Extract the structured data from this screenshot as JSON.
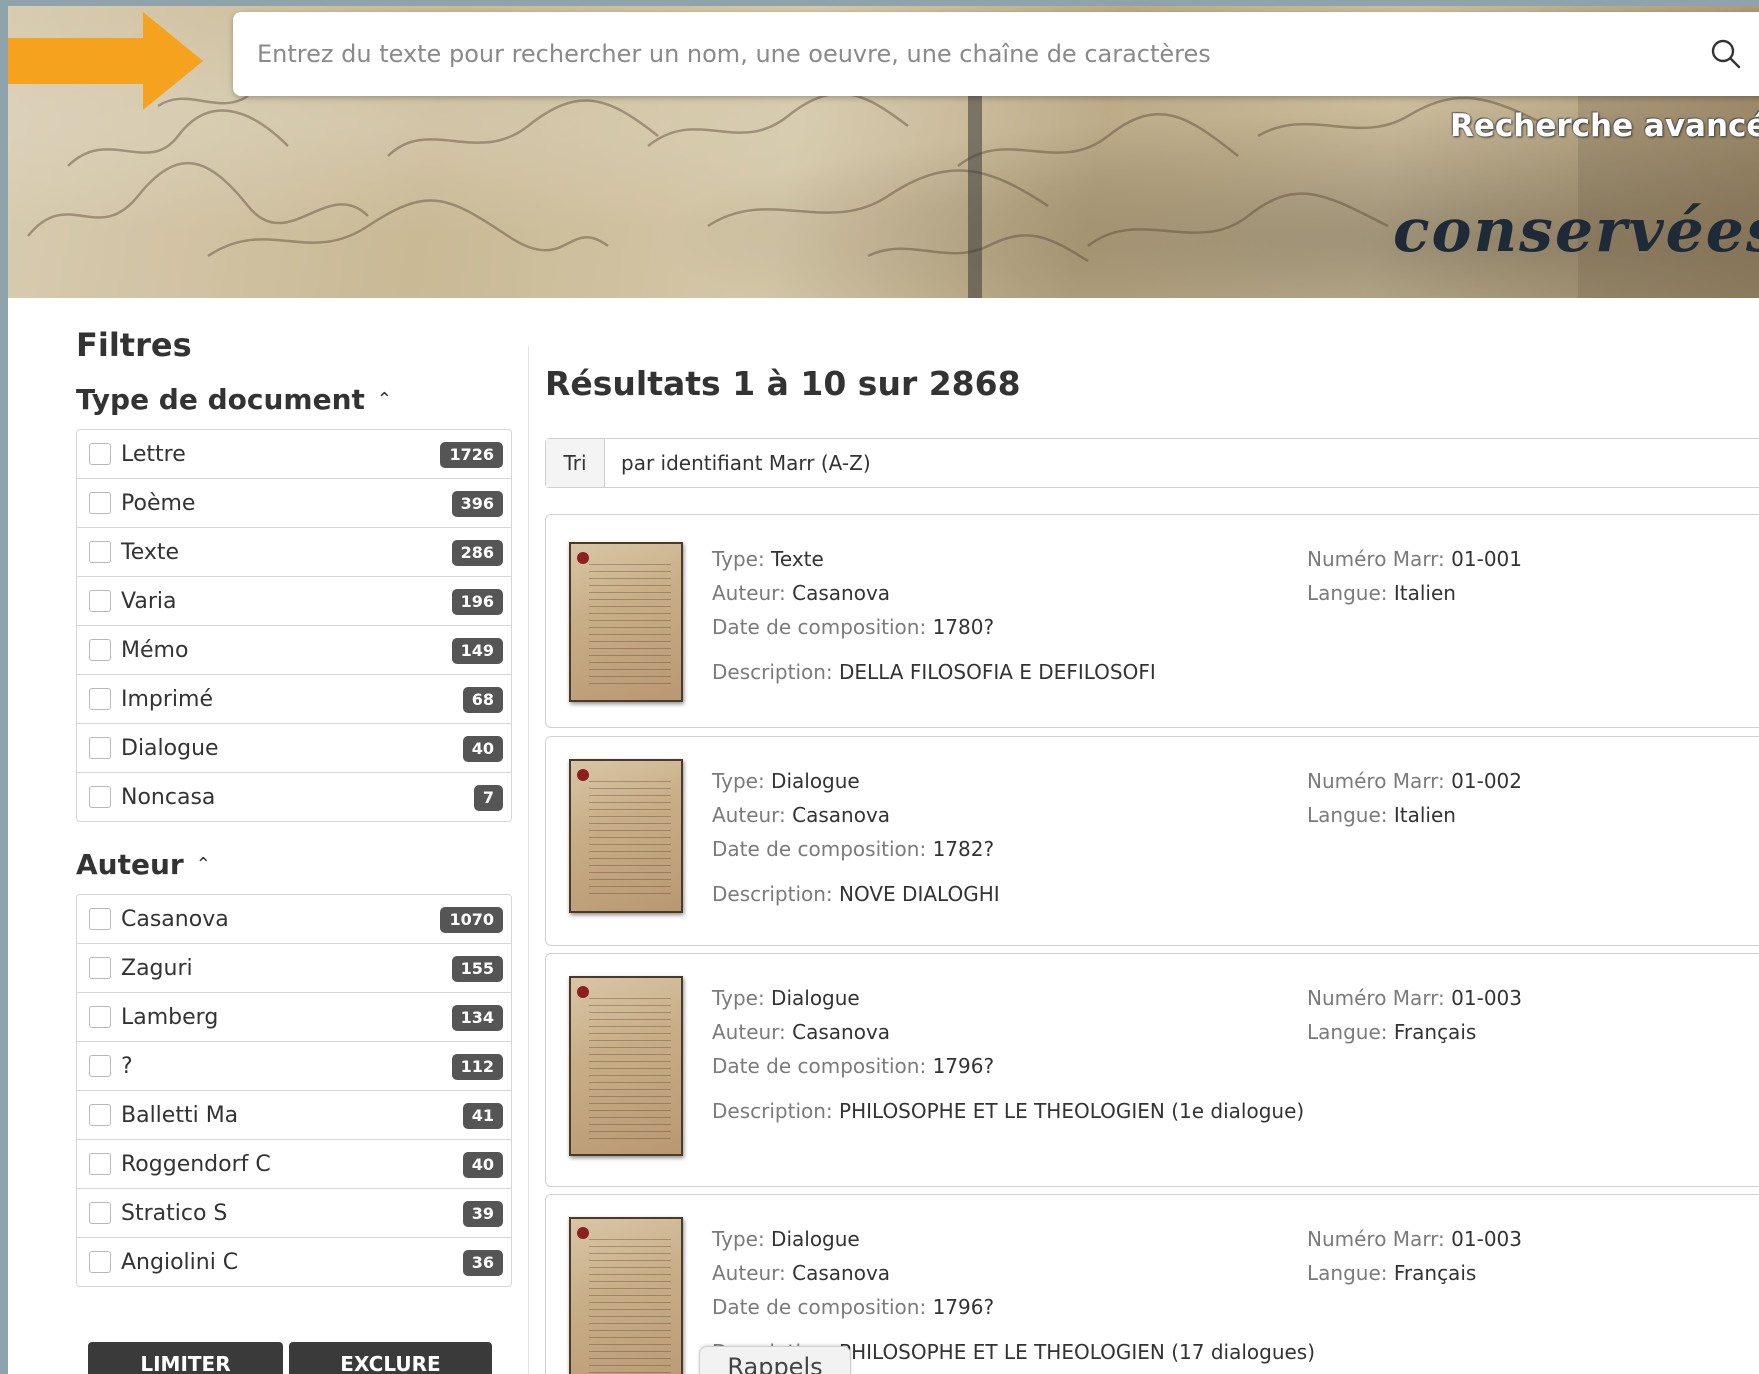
{
  "search": {
    "placeholder": "Entrez du texte pour rechercher un nom, une oeuvre, une chaîne de caractères",
    "icon": "search-icon"
  },
  "banner": {
    "advanced_search_label": "Recherche avancée",
    "script_text": "conservées au"
  },
  "filters": {
    "title": "Filtres",
    "facets": [
      {
        "title": "Type de document",
        "items": [
          {
            "label": "Lettre",
            "count": "1726"
          },
          {
            "label": "Poème",
            "count": "396"
          },
          {
            "label": "Texte",
            "count": "286"
          },
          {
            "label": "Varia",
            "count": "196"
          },
          {
            "label": "Mémo",
            "count": "149"
          },
          {
            "label": "Imprimé",
            "count": "68"
          },
          {
            "label": "Dialogue",
            "count": "40"
          },
          {
            "label": "Noncasa",
            "count": "7"
          }
        ]
      },
      {
        "title": "Auteur",
        "items": [
          {
            "label": "Casanova",
            "count": "1070"
          },
          {
            "label": "Zaguri",
            "count": "155"
          },
          {
            "label": "Lamberg",
            "count": "134"
          },
          {
            "label": "?",
            "count": "112"
          },
          {
            "label": "Balletti Ma",
            "count": "41"
          },
          {
            "label": "Roggendorf C",
            "count": "40"
          },
          {
            "label": "Stratico S",
            "count": "39"
          },
          {
            "label": "Angiolini C",
            "count": "36"
          }
        ]
      }
    ],
    "limit_label": "LIMITER",
    "exclude_label": "EXCLURE"
  },
  "results": {
    "title": "Résultats 1 à 10 sur 2868",
    "sort_label": "Tri",
    "sort_value": "par identifiant Marr (A-Z)",
    "field_labels": {
      "type": "Type:",
      "author": "Auteur:",
      "date": "Date de composition:",
      "description": "Description:",
      "marr": "Numéro Marr:",
      "language": "Langue:"
    },
    "items": [
      {
        "type": "Texte",
        "author": "Casanova",
        "date": "1780?",
        "description": "DELLA FILOSOFIA E DEFILOSOFI",
        "marr": "01-001",
        "language": "Italien"
      },
      {
        "type": "Dialogue",
        "author": "Casanova",
        "date": "1782?",
        "description": "NOVE DIALOGHI",
        "marr": "01-002",
        "language": "Italien"
      },
      {
        "type": "Dialogue",
        "author": "Casanova",
        "date": "1796?",
        "description": "PHILOSOPHE ET LE THEOLOGIEN (1e dialogue)",
        "marr": "01-003",
        "language": "Français"
      },
      {
        "type": "Dialogue",
        "author": "Casanova",
        "date": "1796?",
        "description": "PHILOSOPHE ET LE THEOLOGIEN (17 dialogues)",
        "marr": "01-003",
        "language": "Français"
      }
    ]
  },
  "rappels_label": "Rappels",
  "colors": {
    "accent_arrow": "#f5a21f",
    "badge": "#555555",
    "button": "#3a3a3a"
  }
}
